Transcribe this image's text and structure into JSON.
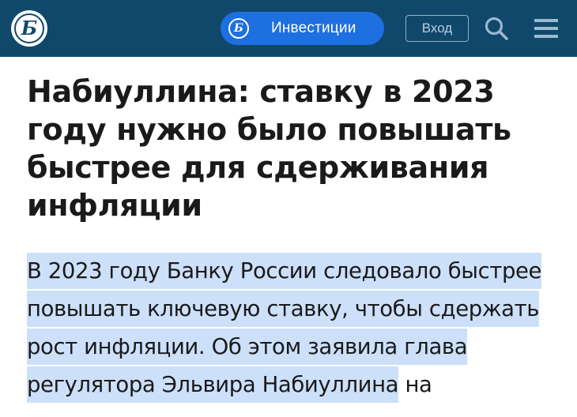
{
  "header": {
    "logo_glyph": "Б",
    "investments_logo_glyph": "Б",
    "investments_label": "Инвестиции",
    "login_label": "Вход",
    "search_icon": "search-icon",
    "menu_icon": "menu-icon",
    "colors": {
      "bar": "#10486b",
      "investments_button": "#1e6fe0",
      "selection": "#cce0fa"
    }
  },
  "article": {
    "title": "Набиуллина: ставку в 2023 году нужно было повышать быстрее для сдерживания инфляции",
    "lead_selected": "В 2023 году Банку России следовало быстрее повышать ключевую ставку, чтобы сдержать рост инфляции. Об этом заявила глава регулятора Эльвира Набиуллина",
    "lead_rest": " на"
  }
}
